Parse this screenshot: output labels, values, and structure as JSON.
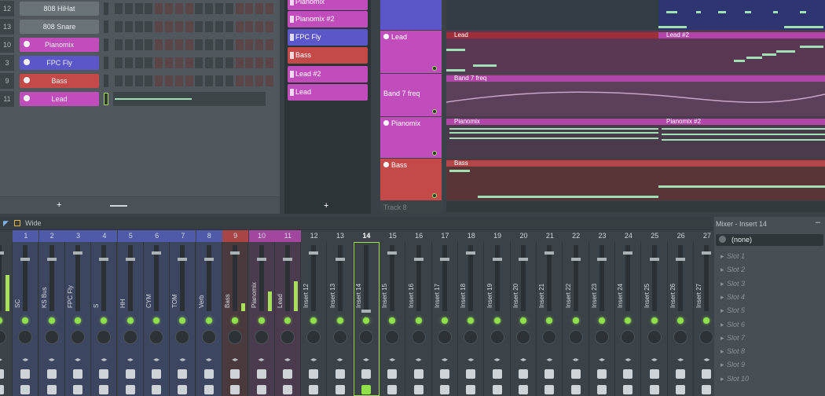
{
  "channel_rack": {
    "rows": [
      {
        "num": "12",
        "name": "808 HiHat",
        "color": "#6a7378",
        "led": false
      },
      {
        "num": "13",
        "name": "808 Snare",
        "color": "#6a7378",
        "led": false
      },
      {
        "num": "10",
        "name": "Pianomix",
        "color": "#c04dbb",
        "led": true
      },
      {
        "num": "3",
        "name": "FPC Fly",
        "color": "#5b57c8",
        "led": true
      },
      {
        "num": "9",
        "name": "Bass",
        "color": "#c44a4a",
        "led": true
      },
      {
        "num": "11",
        "name": "Lead",
        "color": "#c04dbb",
        "led": true
      }
    ],
    "add_label": "+"
  },
  "clip_source": {
    "items": [
      {
        "label": "Pianomix",
        "color": "#c04dbb"
      },
      {
        "label": "Pianomix #2",
        "color": "#c04dbb"
      },
      {
        "label": "FPC Fly",
        "color": "#5b57c8"
      },
      {
        "label": "Bass",
        "color": "#c44a4a"
      },
      {
        "label": "Lead #2",
        "color": "#c04dbb"
      },
      {
        "label": "Lead",
        "color": "#c04dbb"
      }
    ],
    "add_label": "+"
  },
  "tracks": [
    {
      "label": "Lead",
      "color": "#c04dbb"
    },
    {
      "label": "Band 7 freq",
      "color": "#c04dbb"
    },
    {
      "label": "Pianomix",
      "color": "#c04dbb"
    },
    {
      "label": "Bass",
      "color": "#c44a4a"
    },
    {
      "label": "Track 8",
      "color": "#3d4448"
    }
  ],
  "playlist": {
    "lead_a": "Lead",
    "lead_b": "Lead #2",
    "band": "Band 7 freq",
    "piano_a": "Pianomix",
    "piano_b": "Pianomix #2",
    "bass": "Bass"
  },
  "mixer": {
    "preset": "Wide",
    "strips": [
      {
        "num": "",
        "name": "",
        "color": "#3b4348",
        "meter": 0.55
      },
      {
        "num": "1",
        "name": "SC",
        "color": "#4f5aa8",
        "meter": 0
      },
      {
        "num": "2",
        "name": "KS Bus",
        "color": "#4f5aa8",
        "meter": 0
      },
      {
        "num": "3",
        "name": "FPC Fly",
        "color": "#4f5aa8",
        "meter": 0
      },
      {
        "num": "4",
        "name": "S",
        "color": "#4f5aa8",
        "meter": 0
      },
      {
        "num": "5",
        "name": "HH",
        "color": "#4f5aa8",
        "meter": 0
      },
      {
        "num": "6",
        "name": "CYM",
        "color": "#4f5aa8",
        "meter": 0
      },
      {
        "num": "7",
        "name": "TOM",
        "color": "#4f5aa8",
        "meter": 0
      },
      {
        "num": "8",
        "name": "Verb",
        "color": "#4f5aa8",
        "meter": 0
      },
      {
        "num": "9",
        "name": "Bass",
        "color": "#a84646",
        "meter": 0.12
      },
      {
        "num": "10",
        "name": "Pianomix",
        "color": "#a346a0",
        "meter": 0.3
      },
      {
        "num": "11",
        "name": "Lead",
        "color": "#a346a0",
        "meter": 0.45
      },
      {
        "num": "12",
        "name": "Insert 12",
        "color": "#3b4348",
        "meter": 0
      },
      {
        "num": "13",
        "name": "Insert 13",
        "color": "#3b4348",
        "meter": 0
      },
      {
        "num": "14",
        "name": "Insert 14",
        "color": "#3b4348",
        "meter": 0
      },
      {
        "num": "15",
        "name": "Insert 15",
        "color": "#3b4348",
        "meter": 0
      },
      {
        "num": "16",
        "name": "Insert 16",
        "color": "#3b4348",
        "meter": 0
      },
      {
        "num": "17",
        "name": "Insert 17",
        "color": "#3b4348",
        "meter": 0
      },
      {
        "num": "18",
        "name": "Insert 18",
        "color": "#3b4348",
        "meter": 0
      },
      {
        "num": "19",
        "name": "Insert 19",
        "color": "#3b4348",
        "meter": 0
      },
      {
        "num": "20",
        "name": "Insert 20",
        "color": "#3b4348",
        "meter": 0
      },
      {
        "num": "21",
        "name": "Insert 21",
        "color": "#3b4348",
        "meter": 0
      },
      {
        "num": "22",
        "name": "Insert 22",
        "color": "#3b4348",
        "meter": 0
      },
      {
        "num": "23",
        "name": "Insert 23",
        "color": "#3b4348",
        "meter": 0
      },
      {
        "num": "24",
        "name": "Insert 24",
        "color": "#3b4348",
        "meter": 0
      },
      {
        "num": "25",
        "name": "Insert 25",
        "color": "#3b4348",
        "meter": 0
      },
      {
        "num": "26",
        "name": "Insert 26",
        "color": "#3b4348",
        "meter": 0
      },
      {
        "num": "27",
        "name": "Insert 27",
        "color": "#3b4348",
        "meter": 0
      }
    ],
    "selected": "14"
  },
  "mixer_panel": {
    "title": "Mixer - Insert 14",
    "input": "(none)",
    "slots": [
      "Slot 1",
      "Slot 2",
      "Slot 3",
      "Slot 4",
      "Slot 5",
      "Slot 6",
      "Slot 7",
      "Slot 8",
      "Slot 9",
      "Slot 10"
    ]
  }
}
